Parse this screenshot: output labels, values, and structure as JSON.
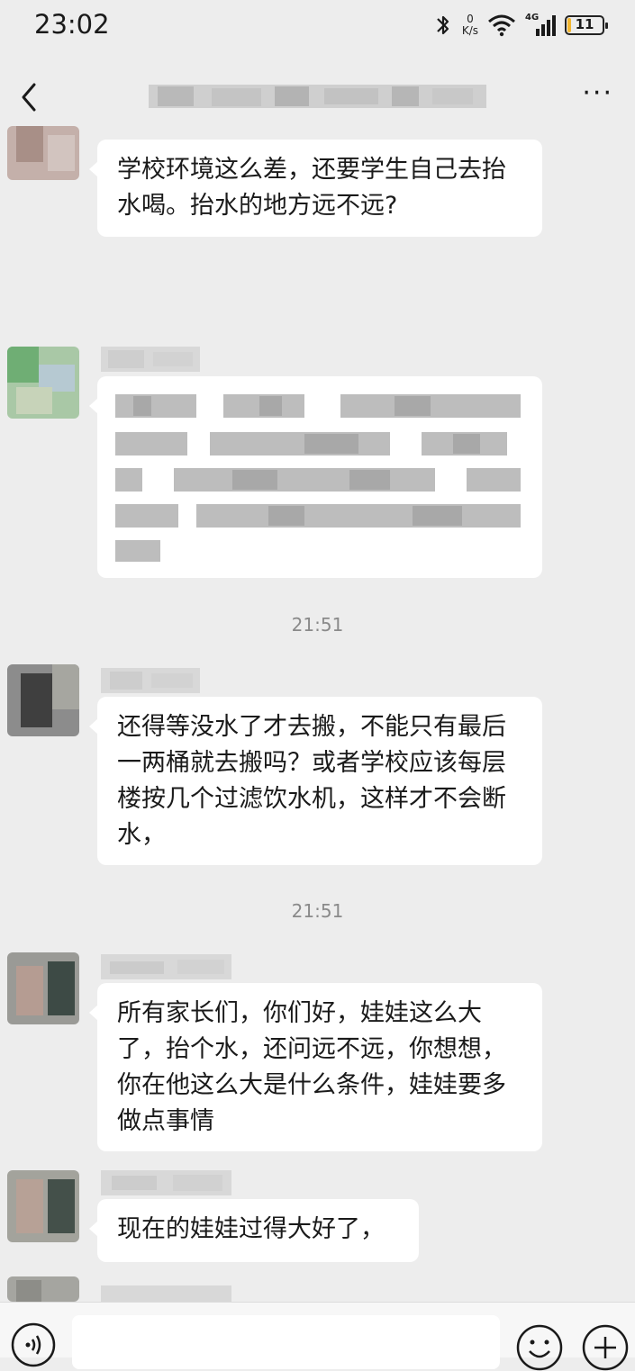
{
  "status_bar": {
    "time": "23:02",
    "net_speed_value": "0",
    "net_speed_unit": "K/s",
    "network_label": "4G",
    "battery_level": "11",
    "battery_percent": 11,
    "icons": [
      "bluetooth-icon",
      "wifi-icon",
      "signal-icon",
      "battery-icon"
    ]
  },
  "nav": {
    "back_icon": "chevron-left-icon",
    "more_icon": "more-icon",
    "more_label": "···"
  },
  "messages": [
    {
      "text": "学校环境这么差，还要学生自己去抬水喝。抬水的地方远不远?"
    },
    {
      "text": ""
    },
    {
      "timestamp": "21:51",
      "text": "还得等没水了才去搬，不能只有最后一两桶就去搬吗？或者学校应该每层楼按几个过滤饮水机，这样才不会断水，"
    },
    {
      "timestamp": "21:51",
      "text": "所有家长们，你们好，娃娃这么大了，抬个水，还问远不远，你想想，你在他这么大是什么条件，娃娃要多做点事情"
    },
    {
      "text": "现在的娃娃过得大好了，"
    }
  ],
  "input_bar": {
    "voice_icon": "voice-icon",
    "emoji_icon": "emoji-icon",
    "plus_icon": "plus-icon"
  },
  "colors": {
    "background": "#ededed",
    "bubble": "#ffffff",
    "battery": "#f2b630"
  }
}
